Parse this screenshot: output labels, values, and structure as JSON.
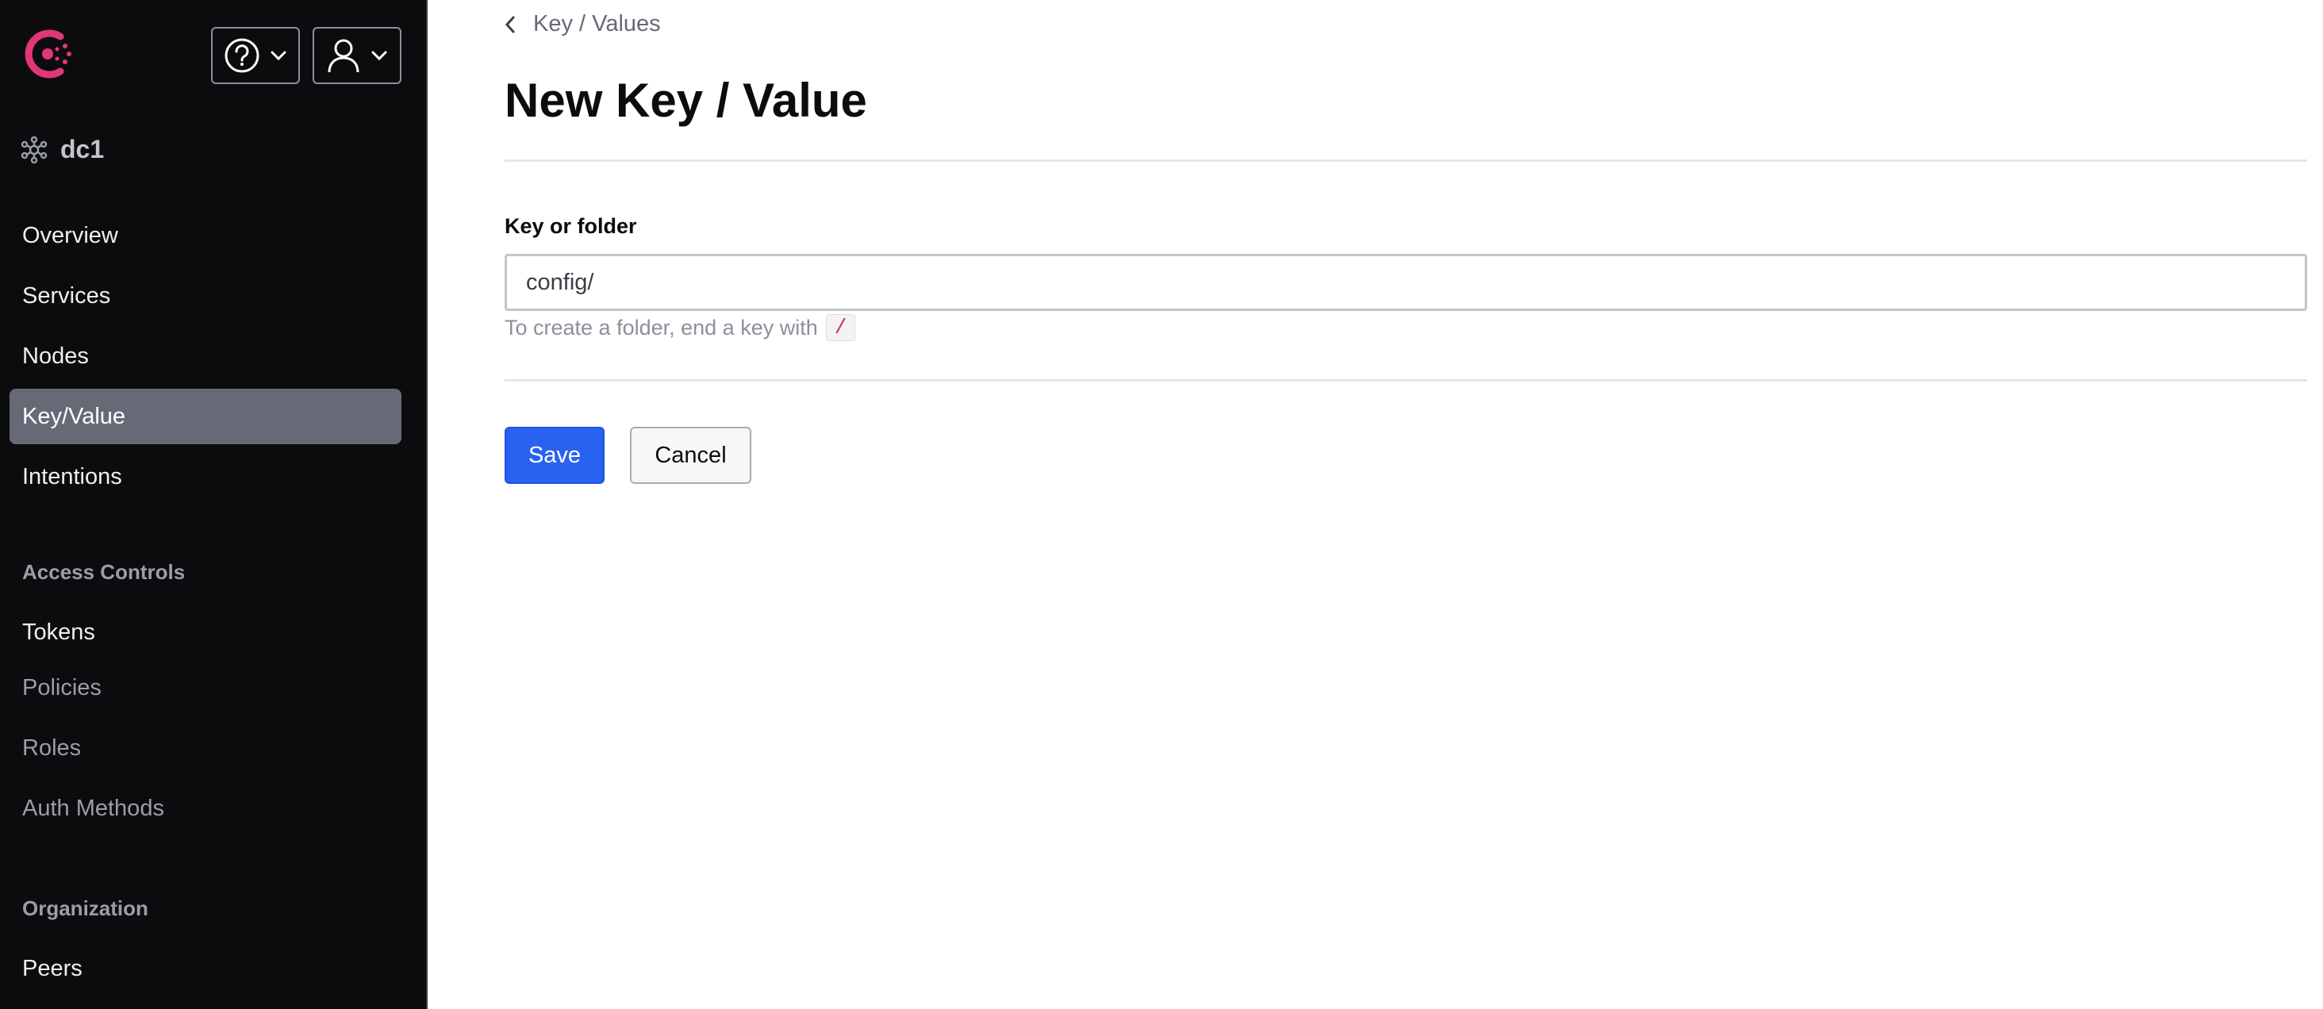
{
  "colors": {
    "sidebar_bg": "#0c0c0e",
    "active_item_bg": "#656a76",
    "brand_accent": "#e03875",
    "primary_button": "#2962f1",
    "code_text": "#c73445"
  },
  "header": {
    "help_icon": "help-circle-icon",
    "user_icon": "user-icon"
  },
  "datacenter": {
    "icon": "cluster-icon",
    "label": "dc1"
  },
  "nav": {
    "overview": "Overview",
    "services": "Services",
    "nodes": "Nodes",
    "key_value": "Key/Value",
    "intentions": "Intentions",
    "access_controls_heading": "Access Controls",
    "tokens": "Tokens",
    "policies": "Policies",
    "roles": "Roles",
    "auth_methods": "Auth Methods",
    "organization_heading": "Organization",
    "peers": "Peers"
  },
  "breadcrumb": {
    "label": "Key / Values"
  },
  "page": {
    "title": "New Key / Value"
  },
  "form": {
    "key_label": "Key or folder",
    "key_value": "config/",
    "hint_text": "To create a folder, end a key with",
    "hint_code": "/"
  },
  "actions": {
    "save": "Save",
    "cancel": "Cancel"
  }
}
